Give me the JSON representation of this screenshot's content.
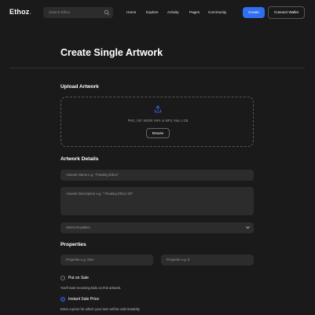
{
  "nav": {
    "logo_main": "Ethoz",
    "logo_dot": ".",
    "search_placeholder": "Search Ethoz",
    "links": [
      "Home",
      "Explore",
      "Activity",
      "Pages",
      "Community"
    ],
    "create_label": "Create",
    "wallet_label": "Connect Wallet"
  },
  "page": {
    "title": "Create Single Artwork"
  },
  "upload": {
    "heading": "Upload Artwork",
    "formats": "PNG, GIF, WEBP, MP4 or MP3. Max 1 GB",
    "browse_label": "Browse"
  },
  "details": {
    "heading": "Artwork Details",
    "name_placeholder": "Artwork Name e.g. \"Floating Ethoz\"",
    "description_placeholder": "Artwork Description e.g. \" Floating Ethoz 3D\"",
    "royalties_placeholder": "Select Royalties"
  },
  "properties": {
    "heading": "Properties",
    "field1_placeholder": "Propertie e.g. Size",
    "field2_placeholder": "Propertie e.g. 8"
  },
  "sale": {
    "put_on_sale_label": "Put on Sale",
    "put_on_sale_help": "You'll start receiving bids on this artwork.",
    "instant_label": "Instant Sale Price",
    "instant_help": "Enter a price for which your item will be sold instantly"
  },
  "colors": {
    "accent": "#2f6ff0",
    "background": "#1a1a1a",
    "field": "#2c2c2c"
  }
}
